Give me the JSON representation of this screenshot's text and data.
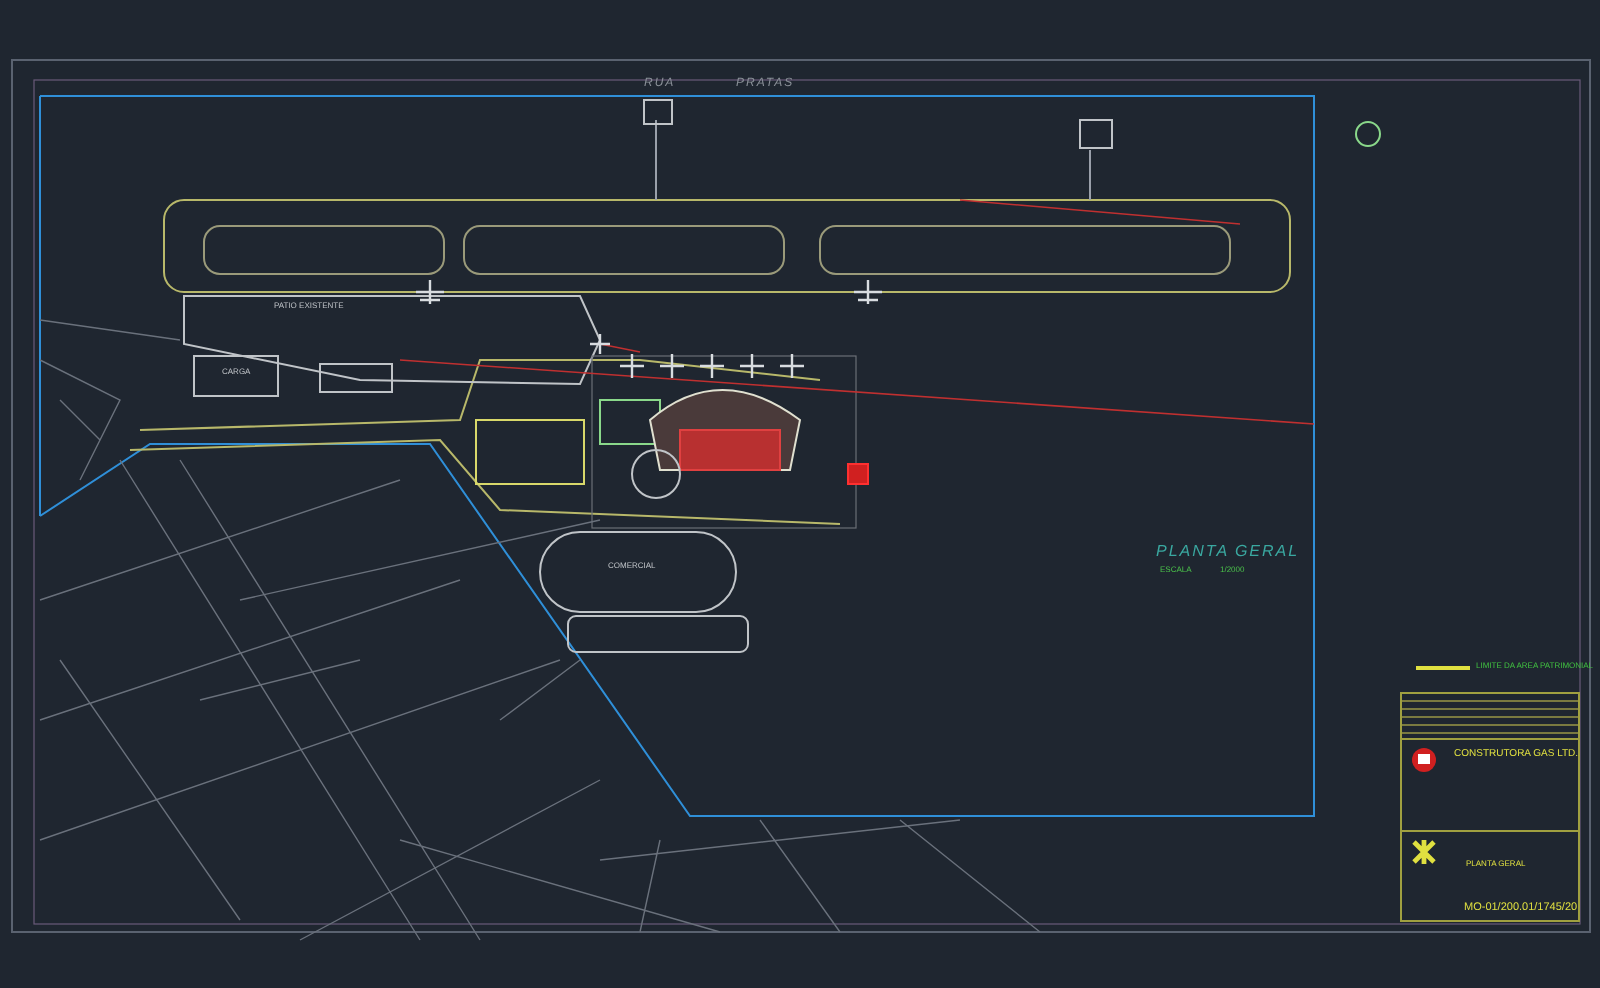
{
  "drawing": {
    "street_labels": [
      {
        "text": "RUA"
      },
      {
        "text": "PRATAS"
      }
    ],
    "area_labels": [
      {
        "text": "PATIO EXISTENTE"
      },
      {
        "text": "CARGA"
      },
      {
        "text": "COMERCIAL"
      }
    ],
    "plan_title": {
      "title": "PLANTA GERAL",
      "scale_label": "ESCALA",
      "scale": "1/2000"
    }
  },
  "title_block": {
    "legend": "LIMITE DA AREA PATRIMONIAL",
    "company": "CONSTRUTORA GAS LTD.",
    "sheet_title": "PLANTA GERAL",
    "drawing_number": "MO-01/200.01/1745/20"
  }
}
